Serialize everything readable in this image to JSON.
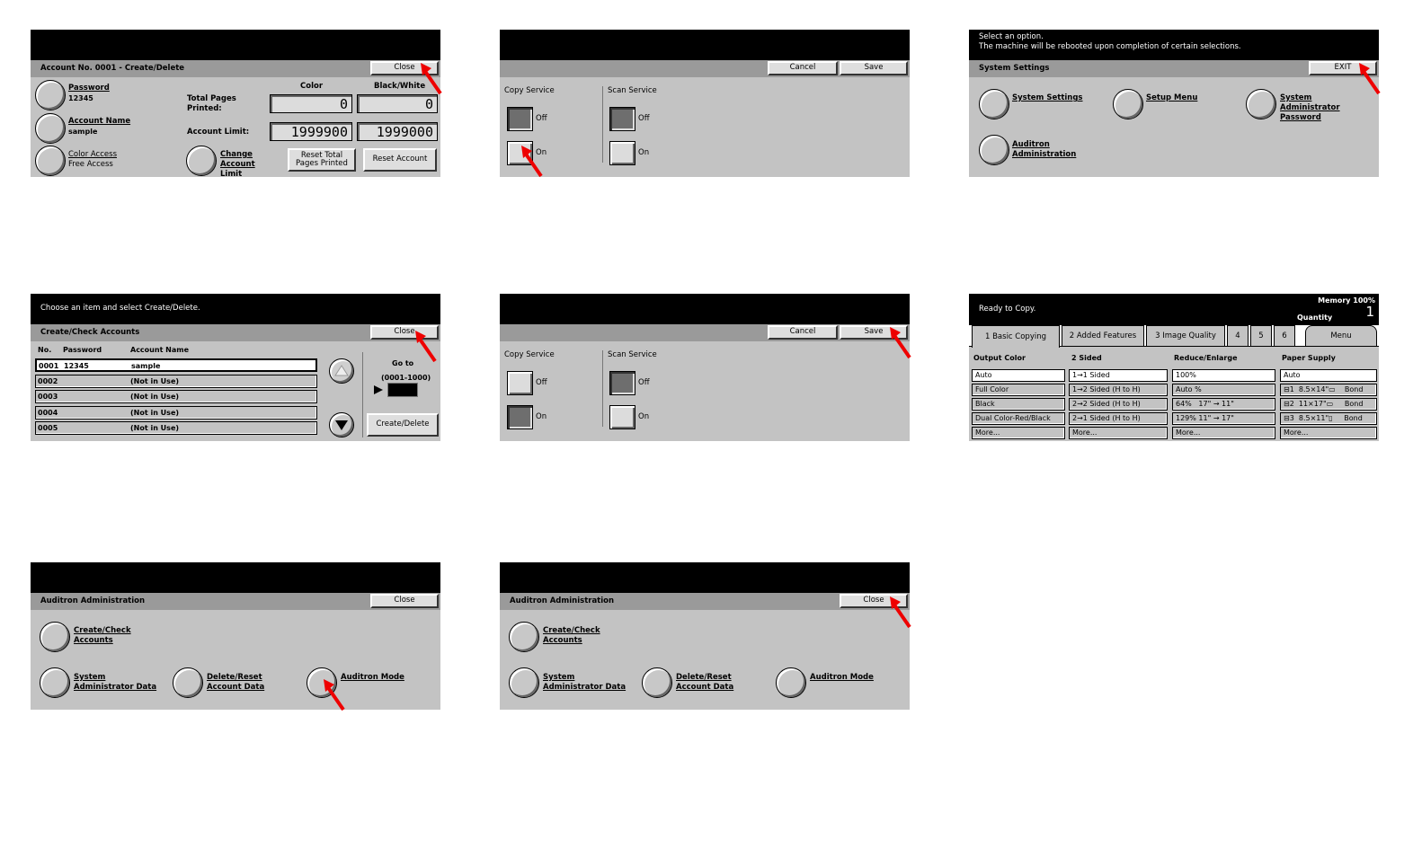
{
  "p1": {
    "title": "Account No. 0001 - Create/Delete",
    "close": "Close",
    "password_label": "Password",
    "password_value": "12345",
    "account_name_label": "Account Name",
    "account_name_value": "sample",
    "color_access_label": "Color Access",
    "color_access_value": "Free Access",
    "col_color": "Color",
    "col_bw": "Black/White",
    "total_pages_label": "Total Pages Printed:",
    "total_color": "0",
    "total_bw": "0",
    "limit_label": "Account Limit:",
    "limit_color": "1999900",
    "limit_bw": "1999000",
    "change_limit": "Change Account Limit",
    "reset_total": "Reset Total Pages Printed",
    "reset_account": "Reset Account"
  },
  "p2": {
    "cancel": "Cancel",
    "save": "Save",
    "copy_service": "Copy Service",
    "scan_service": "Scan Service",
    "off": "Off",
    "on": "On"
  },
  "p3": {
    "msg1": "Select an option.",
    "msg2": "The machine will be rebooted upon completion of certain selections.",
    "title": "System Settings",
    "exit": "EXIT",
    "system_settings": "System Settings",
    "setup_menu": "Setup Menu",
    "sys_admin_password": "System Administrator Password",
    "auditron_admin": "Auditron Administration"
  },
  "p4": {
    "msg": "Choose an item and select Create/Delete.",
    "title": "Create/Check Accounts",
    "close": "Close",
    "col_no": "No.",
    "col_password": "Password",
    "col_account": "Account Name",
    "rows": [
      {
        "no": "0001",
        "password": "12345",
        "name": "sample"
      },
      {
        "no": "0002",
        "password": "",
        "name": "(Not in Use)"
      },
      {
        "no": "0003",
        "password": "",
        "name": "(Not in Use)"
      },
      {
        "no": "0004",
        "password": "",
        "name": "(Not in Use)"
      },
      {
        "no": "0005",
        "password": "",
        "name": "(Not in Use)"
      }
    ],
    "goto_label": "Go to",
    "goto_range": "(0001-1000)",
    "create_delete": "Create/Delete"
  },
  "p5": {
    "cancel": "Cancel",
    "save": "Save",
    "copy_service": "Copy Service",
    "scan_service": "Scan Service",
    "off": "Off",
    "on": "On"
  },
  "p6": {
    "status": "Ready to Copy.",
    "memory": "Memory 100%",
    "quantity_label": "Quantity",
    "quantity_value": "1",
    "tabs": [
      "1 Basic Copying",
      "2 Added Features",
      "3 Image Quality",
      "4",
      "5",
      "6"
    ],
    "menu": "Menu",
    "col_output": "Output Color",
    "col_sided": "2 Sided",
    "col_reduce": "Reduce/Enlarge",
    "col_paper": "Paper Supply",
    "output": [
      "Auto",
      "Full Color",
      "Black",
      "Dual Color-Red/Black",
      "More..."
    ],
    "sided": [
      "1→1 Sided",
      "1→2 Sided (H to H)",
      "2→2 Sided (H to H)",
      "2→1 Sided (H to H)",
      "More..."
    ],
    "reduce": [
      "100%",
      "Auto %",
      "64%   17\" → 11\"",
      "129% 11\" → 17\"",
      "More..."
    ],
    "paper": [
      "Auto",
      "⊟1  8.5×14\"▭    Bond",
      "⊟2  11×17\"▭     Bond",
      "⊟3  8.5×11\"▯     Bond",
      "More..."
    ]
  },
  "p7": {
    "title": "Auditron Administration",
    "close": "Close",
    "create_check": "Create/Check Accounts",
    "sys_admin_data": "System Administrator Data",
    "delete_reset": "Delete/Reset Account Data",
    "auditron_mode": "Auditron Mode"
  },
  "p8": {
    "title": "Auditron Administration",
    "close": "Close",
    "create_check": "Create/Check Accounts",
    "sys_admin_data": "System Administrator Data",
    "delete_reset": "Delete/Reset Account Data",
    "auditron_mode": "Auditron Mode"
  }
}
